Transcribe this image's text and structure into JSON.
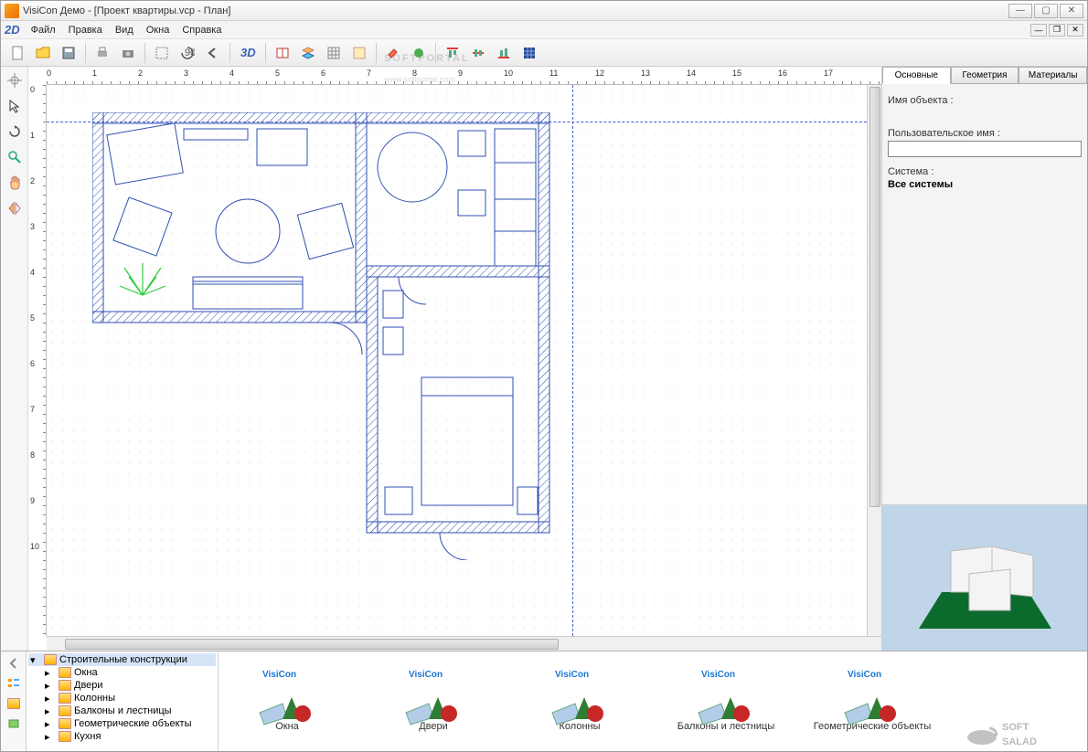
{
  "window": {
    "title": "VisiCon Демо - [Проект квартиры.vcp - План]"
  },
  "menu": {
    "logo": "2D",
    "items": [
      "Файл",
      "Правка",
      "Вид",
      "Окна",
      "Справка"
    ]
  },
  "toolbar": {
    "mode3d": "3D",
    "icons": [
      "new-file",
      "open-file",
      "save",
      "print",
      "camera",
      "group",
      "rotate90",
      "undo",
      "3d",
      "window-tool",
      "layers",
      "grid-tool",
      "hatch",
      "paint",
      "align-left",
      "align-center",
      "align-right",
      "mesh"
    ]
  },
  "lefttools": [
    "pointer",
    "rotate",
    "zoom",
    "pan",
    "flip"
  ],
  "ruler": {
    "h": [
      "0",
      "1",
      "2",
      "3",
      "4",
      "5",
      "6",
      "7",
      "8",
      "9",
      "10",
      "11",
      "12",
      "13",
      "14",
      "15",
      "16",
      "17"
    ],
    "v": [
      "0",
      "1",
      "2",
      "3",
      "4",
      "5",
      "6",
      "7",
      "8",
      "9",
      "10"
    ]
  },
  "rightpanel": {
    "tabs": [
      "Основные",
      "Геометрия",
      "Материалы"
    ],
    "labels": {
      "objname": "Имя объекта :",
      "username": "Пользовательское имя :",
      "system": "Система :",
      "system_value": "Все системы"
    },
    "values": {
      "objname": "",
      "username": ""
    }
  },
  "library": {
    "root": "Строительные конструкции",
    "folders": [
      "Окна",
      "Двери",
      "Колонны",
      "Балконы и лестницы",
      "Геометрические объекты",
      "Кухня"
    ],
    "brand": "VisiCon",
    "items": [
      {
        "label": "Окна"
      },
      {
        "label": "Двери"
      },
      {
        "label": "Колонны"
      },
      {
        "label": "Балконы и лестницы"
      },
      {
        "label": "Геометрические объекты"
      }
    ]
  },
  "watermarks": {
    "portal": "SOFTPORTAL",
    "portal_url": "www.softportal.com",
    "salad": "SOFT SALAD"
  }
}
